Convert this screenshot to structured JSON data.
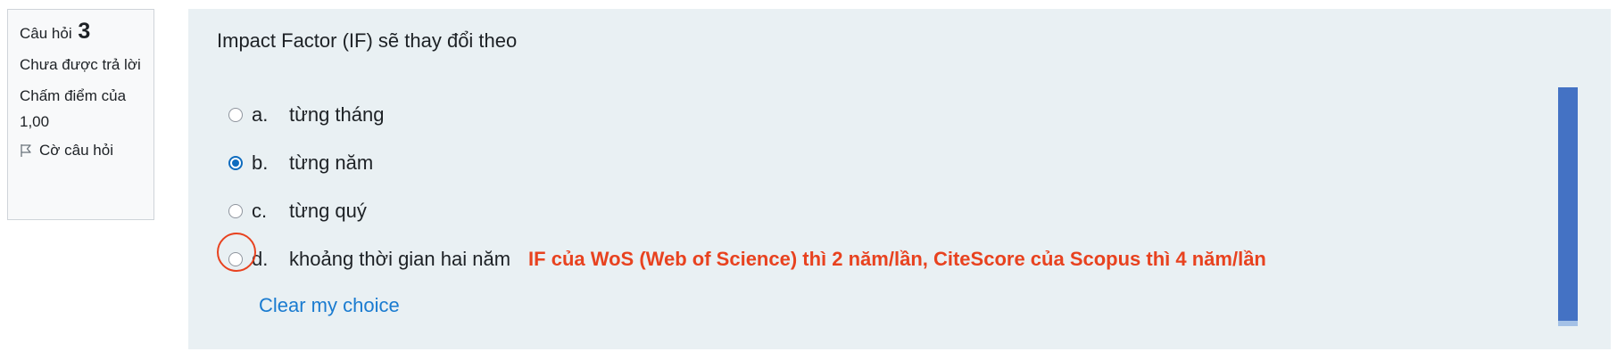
{
  "info": {
    "question_label": "Câu hỏi",
    "question_number": "3",
    "state": "Chưa được trả lời",
    "grade": "Chấm điểm của 1,00",
    "flag_label": "Cờ câu hỏi"
  },
  "question": {
    "text": "Impact Factor (IF) sẽ thay đổi theo",
    "options": [
      {
        "letter": "a.",
        "text": "từng tháng",
        "selected": false
      },
      {
        "letter": "b.",
        "text": "từng năm",
        "selected": true
      },
      {
        "letter": "c.",
        "text": "từng quý",
        "selected": false
      },
      {
        "letter": "d.",
        "text": "khoảng thời gian hai năm",
        "selected": false
      }
    ],
    "annotation": "IF của WoS (Web of Science) thì 2 năm/lần, CiteScore của Scopus thì 4 năm/lần",
    "clear_label": "Clear my choice"
  },
  "colors": {
    "selected": "#0f6cbf",
    "annotation": "#e8421f",
    "side_bar": "#4472c4",
    "content_bg": "#e9f0f3"
  },
  "icons": {
    "flag": "flag-outline-icon"
  }
}
